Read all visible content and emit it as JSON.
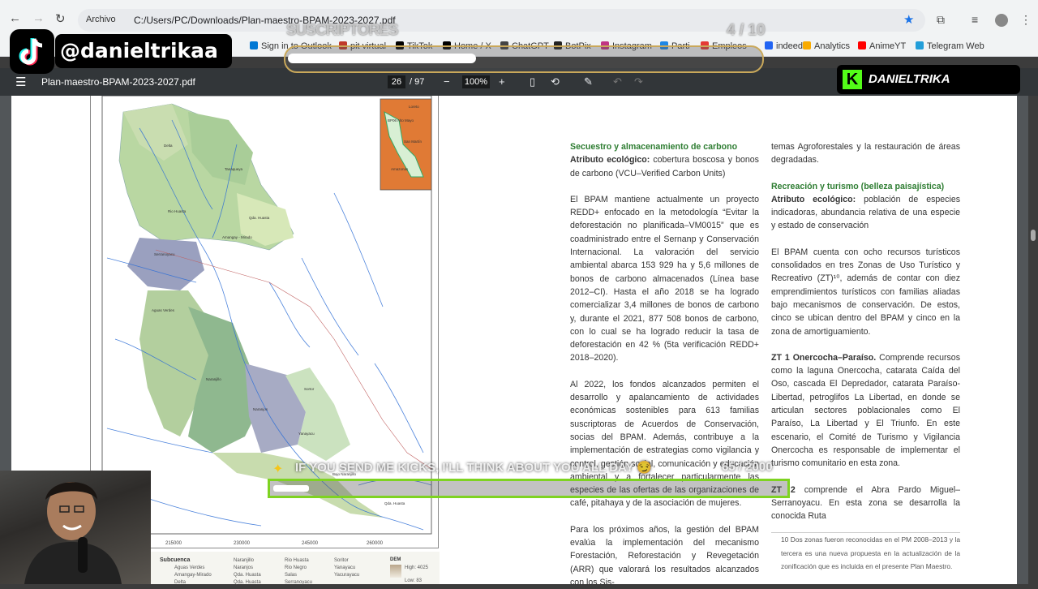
{
  "browser": {
    "info_label": "Archivo",
    "url": "C:/Users/PC/Downloads/Plan-maestro-BPAM-2023-2027.pdf",
    "bookmarks": [
      {
        "label": "Sign in to Outlook",
        "color": "#0078d4"
      },
      {
        "label": "pit virtual",
        "color": "#c0392b"
      },
      {
        "label": "TikTok",
        "color": "#000000"
      },
      {
        "label": "Home / X",
        "color": "#000000"
      },
      {
        "label": "ChatGPT",
        "color": "#444444"
      },
      {
        "label": "BotPix",
        "color": "#222222"
      },
      {
        "label": "Instagram",
        "color": "#c13584"
      },
      {
        "label": "Parti",
        "color": "#1e88e5"
      },
      {
        "label": "Empleos",
        "color": "#e53935"
      },
      {
        "label": "indeed",
        "color": "#2164f3"
      },
      {
        "label": "Analytics",
        "color": "#f9ab00"
      },
      {
        "label": "AnimeYT",
        "color": "#ff0000"
      },
      {
        "label": "Telegram Web",
        "color": "#229ed9"
      }
    ]
  },
  "pdf": {
    "title": "Plan-maestro-BPAM-2023-2027.pdf",
    "page_current": "26",
    "page_total": "/ 97",
    "zoom": "100%"
  },
  "map": {
    "subbasins": [
      "Delta",
      "Tanaqueya",
      "Rio Huasta",
      "Qda. Huasta",
      "Amangay - Mirado",
      "Serranoyacu",
      "Aguas Verdes",
      "Naranjillo",
      "Naranjos",
      "Sortor",
      "Yanayacu",
      "Bajo Naranjillo",
      "Qda. Huasta"
    ],
    "x_ticks": [
      "200000",
      "215000",
      "230000",
      "245000",
      "260000"
    ],
    "inset_labels": [
      "Loreto",
      "BP06 Alto Mayo",
      "San Martín",
      "Amazonas"
    ],
    "legend": {
      "title": "Subcuenca",
      "items": [
        "Aguas Verdes",
        "Amangay-Mirado",
        "Delta",
        "Naranjillo",
        "Naranjos",
        "Qda. Huasta",
        "Qda. Huasta",
        "Rio Huasta",
        "Rio Negro",
        "Salas",
        "Serranoyacu",
        "Soritor",
        "Yanayacu",
        "Yacurayacu"
      ],
      "dem_title": "DEM",
      "dem_high": "High: 4025",
      "dem_low": "Low: 83"
    }
  },
  "text": {
    "col1": {
      "heading1": "Secuestro y almacenamiento de carbono",
      "attr_label": "Atributo ecológico:",
      "attr_text": " cobertura boscosa y bonos de carbono (VCU–Verified Carbon Units)",
      "p1": "El BPAM mantiene actualmente un proyecto REDD+ enfocado en la metodología “Evitar la deforestación no planificada–VM0015” que es coadministrado entre el Sernanp y Conservación Internacional. La valoración del servicio ambiental abarca 153 929 ha y 5,6 millones de bonos de carbono almacenados (Línea base 2012–CI). Hasta el año 2018 se ha logrado comercializar 3,4 millones de bonos de carbono y, durante el 2021, 877 508 bonos de carbono, con lo cual se ha logrado reducir la tasa de deforestación en 42 % (5ta verificación REDD+ 2018–2020).",
      "p2": "Al 2022, los fondos alcanzados permiten el desarrollo y apalancamiento de actividades económicas sostenibles para 613 familias suscriptoras de Acuerdos de Conservación, socias del BPAM. Además, contribuye a la implementación de estrategias como vigilancia y control, gestión social, comunicación y educación ambiental y a fortalecer particularmente las especies de las ofertas de las organizaciones de café, pitahaya y de la asociación de mujeres.",
      "p3": "Para los próximos años, la gestión del BPAM evalúa la implementación del mecanismo Forestación, Reforestación y Revegetación (ARR) que valorará los resultados alcanzados con los Sis-"
    },
    "col2": {
      "p0": "temas Agroforestales y la restauración de áreas degradadas.",
      "heading2": "Recreación y turismo (belleza paisajística)",
      "attr_label": "Atributo ecológico:",
      "attr_text": " población de especies indicadoras, abundancia relativa de una especie y estado de conservación",
      "p1": "El BPAM cuenta con ocho recursos turísticos consolidados en tres Zonas de Uso Turístico y Recreativo (ZT)¹⁰, además de contar con diez emprendimientos turísticos con familias aliadas bajo mecanismos de conservación. De estos, cinco se ubican dentro del BPAM y cinco en la zona de amortiguamiento.",
      "zt1_label": "ZT 1 Onercocha–Paraíso.",
      "zt1_text": " Comprende recursos como la laguna Onercocha, catarata Caída del Oso, cascada El Depredador, catarata Paraíso-Libertad, petroglifos La Libertad, en donde se articulan sectores poblacionales como El Paraíso, La Libertad y El Triunfo. En este escenario, el Comité de Turismo y Vigilancia Onercocha es responsable de implementar el turismo comunitario en esta zona.",
      "zt2_label": "ZT 2",
      "zt2_text": " comprende el Abra Pardo Miguel–Serranoyacu. En esta zona se desarrolla la conocida Ruta",
      "footnote": "10  Dos zonas fueron reconocidas en el PM 2008–2013 y la tercera es una nueva propuesta en la actualización de la zonificación que es incluida en el presente Plan Maestro."
    }
  },
  "overlay": {
    "tiktok_handle": "@danieltrikaa",
    "subs_label": "SUSCRIPTORES",
    "subs_count": "4 / 10",
    "subs_progress": 0.4,
    "kick_name": "DANIELTRIKA",
    "kicks_message": "IF YOU SEND ME KICKS, I'LL THINK ABOUT YOU ALL DAY 😏",
    "kicks_count": "65 / 2000",
    "kicks_progress": 0.0325
  }
}
